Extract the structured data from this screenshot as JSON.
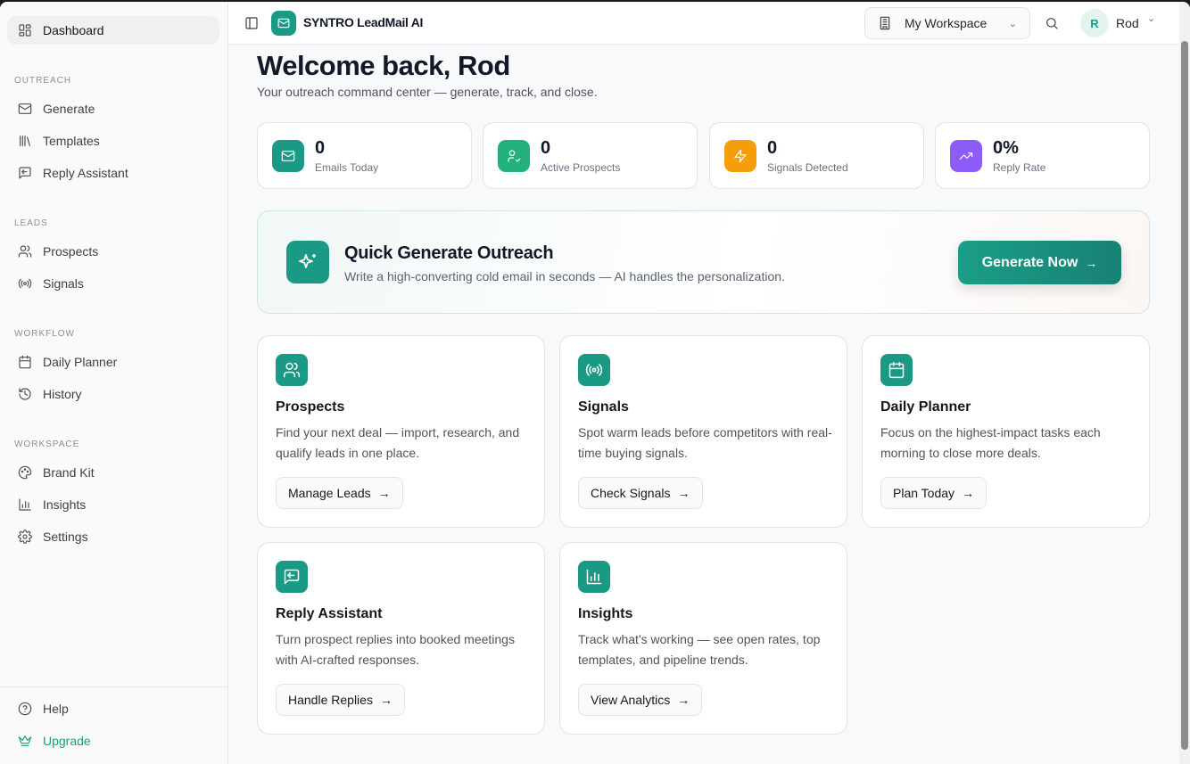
{
  "sidebar": {
    "dashboard": "Dashboard",
    "sections": [
      "OUTREACH",
      "LEADS",
      "WORKFLOW",
      "WORKSPACE"
    ],
    "items": [
      "Generate",
      "Templates",
      "Reply Assistant",
      "Prospects",
      "Signals",
      "Daily Planner",
      "History",
      "Brand Kit",
      "Insights",
      "Settings"
    ],
    "help": "Help",
    "upgrade": "Upgrade"
  },
  "header": {
    "brand": "SYNTRO LeadMail AI",
    "workspace": "My Workspace",
    "avatar_initial": "R",
    "user": "Rod"
  },
  "main": {
    "title": "Welcome back, Rod",
    "subtitle": "Your outreach command center — generate, track, and close.",
    "stats": [
      {
        "value": "0",
        "label": "Emails Today",
        "color": "#1a9a85"
      },
      {
        "value": "0",
        "label": "Active Prospects",
        "color": "#22b07d"
      },
      {
        "value": "0",
        "label": "Signals Detected",
        "color": "#f59e0b"
      },
      {
        "value": "0%",
        "label": "Reply Rate",
        "color": "#8b5cf6"
      }
    ],
    "quick": {
      "title": "Quick Generate Outreach",
      "subtitle": "Write a high-converting cold email in seconds — AI handles the personalization.",
      "button": "Generate Now"
    },
    "cards": [
      {
        "title": "Prospects",
        "desc": "Find your next deal — import, research, and qualify leads in one place.",
        "button": "Manage Leads"
      },
      {
        "title": "Signals",
        "desc": "Spot warm leads before competitors with real-time buying signals.",
        "button": "Check Signals"
      },
      {
        "title": "Daily Planner",
        "desc": "Focus on the highest-impact tasks each morning to close more deals.",
        "button": "Plan Today"
      },
      {
        "title": "Reply Assistant",
        "desc": "Turn prospect replies into booked meetings with AI-crafted responses.",
        "button": "Handle Replies"
      },
      {
        "title": "Insights",
        "desc": "Track what's working — see open rates, top templates, and pipeline trends.",
        "button": "View Analytics"
      }
    ]
  }
}
